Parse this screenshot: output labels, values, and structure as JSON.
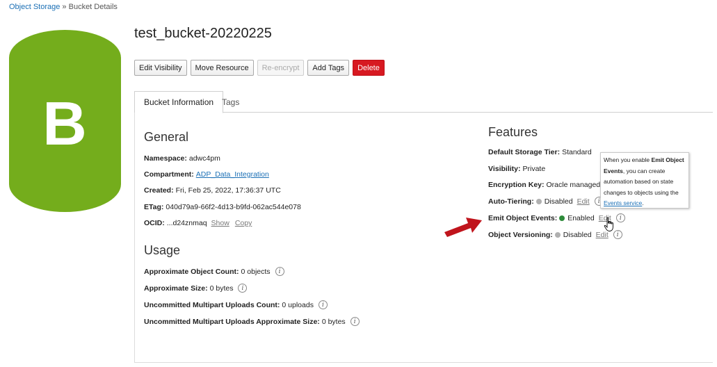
{
  "breadcrumb": {
    "root": "Object Storage",
    "separator": " » ",
    "current": "Bucket Details"
  },
  "logo": {
    "letter": "B",
    "color": "#74ad1c"
  },
  "bucket": {
    "name": "test_bucket-20220225"
  },
  "toolbar": {
    "edit_visibility": "Edit Visibility",
    "move_resource": "Move Resource",
    "reencrypt": "Re-encrypt",
    "add_tags": "Add Tags",
    "delete": "Delete"
  },
  "tabs": {
    "bucket_info": "Bucket Information",
    "tags": "Tags"
  },
  "general": {
    "title": "General",
    "namespace": {
      "label": "Namespace:",
      "value": "adwc4pm"
    },
    "compartment": {
      "label": "Compartment:",
      "value": "ADP_Data_Integration"
    },
    "created": {
      "label": "Created:",
      "value": "Fri, Feb 25, 2022, 17:36:37 UTC"
    },
    "etag": {
      "label": "ETag:",
      "value": "040d79a9-66f2-4d13-b9fd-062ac544e078"
    },
    "ocid": {
      "label": "OCID:",
      "value": "...d24znmaq",
      "show": "Show",
      "copy": "Copy"
    }
  },
  "usage": {
    "title": "Usage",
    "object_count": {
      "label": "Approximate Object Count:",
      "value": "0 objects"
    },
    "size": {
      "label": "Approximate Size:",
      "value": "0 bytes"
    },
    "multipart_count": {
      "label": "Uncommitted Multipart Uploads Count:",
      "value": "0 uploads"
    },
    "multipart_size": {
      "label": "Uncommitted Multipart Uploads Approximate Size:",
      "value": "0 bytes"
    }
  },
  "features": {
    "title": "Features",
    "storage_tier": {
      "label": "Default Storage Tier:",
      "value": "Standard"
    },
    "visibility": {
      "label": "Visibility:",
      "value": "Private"
    },
    "encryption": {
      "label": "Encryption Key:",
      "value": "Oracle managed key"
    },
    "auto_tiering": {
      "label": "Auto-Tiering:",
      "value": "Disabled",
      "edit": "Edit"
    },
    "emit_events": {
      "label": "Emit Object Events:",
      "value": "Enabled",
      "edit": "Edit"
    },
    "versioning": {
      "label": "Object Versioning:",
      "value": "Disabled",
      "edit": "Edit"
    }
  },
  "tooltip": {
    "text1": "When you enable ",
    "bold": "Emit Object Events",
    "text2": ", you can create automation based on state changes to objects using the ",
    "link": "Events service",
    "text3": "."
  },
  "colors": {
    "accent": "#1a6fb5",
    "danger": "#d71921",
    "enabled": "#2e8b3a",
    "arrow": "#c0141c"
  }
}
